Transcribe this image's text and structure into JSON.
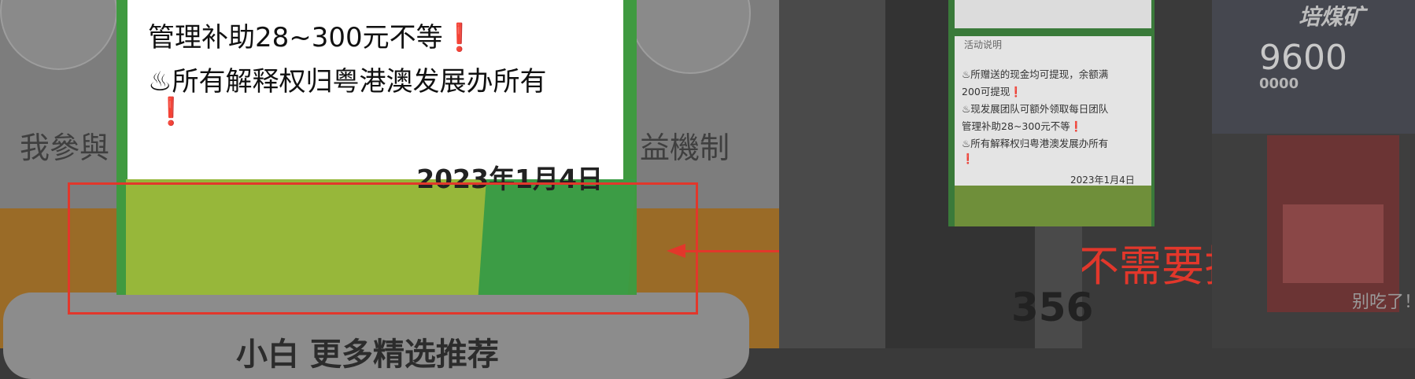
{
  "popup": {
    "line1": "管理补助28~300元不等",
    "line2": "♨所有解释权归粤港澳发展办所有",
    "excl": "❗",
    "date": "2023年1月4日"
  },
  "left_screen": {
    "caption_left": "我參與",
    "caption_right": "益機制",
    "bottom_title": "小白 更多精选推荐"
  },
  "annotation": {
    "text": "上下不需要拉伸"
  },
  "middle_screen": {
    "card_label": "活动说明",
    "lines": [
      "♨所赠送的现金均可提现，余额满",
      "200可提现❗",
      "♨现发展团队可额外领取每日团队",
      "管理补助28~300元不等❗",
      "♨所有解释权归粤港澳发展办所有",
      "❗"
    ],
    "date": "2023年1月4日",
    "number": "356"
  },
  "right_screen": {
    "title": "培煤矿",
    "big_number": "9600",
    "small_number": "0000",
    "caption": "别吃了！"
  },
  "colors": {
    "annotation_red": "#e2372b",
    "popup_green": "#3f9a40",
    "popup_lime": "#97b73a"
  }
}
